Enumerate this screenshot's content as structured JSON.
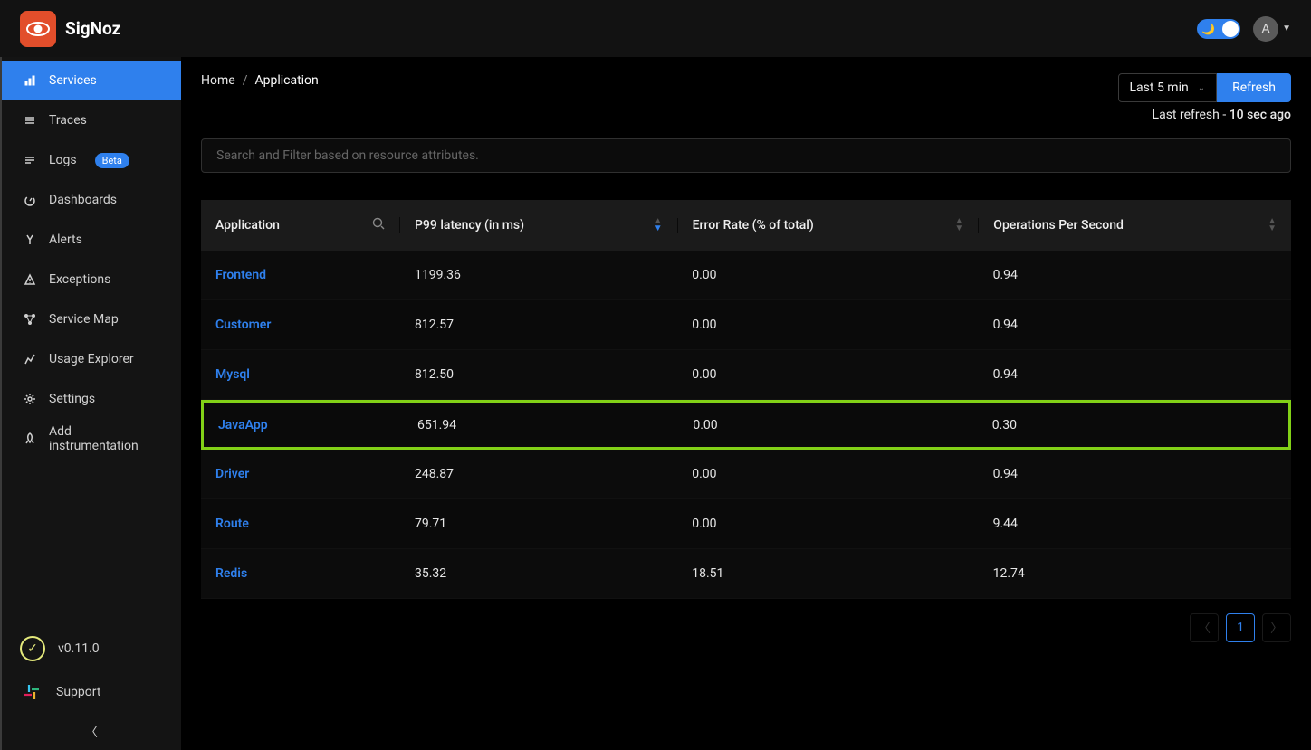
{
  "brand": "SigNoz",
  "avatar_initial": "A",
  "sidebar": {
    "items": [
      {
        "label": "Services",
        "active": true
      },
      {
        "label": "Traces"
      },
      {
        "label": "Logs",
        "badge": "Beta"
      },
      {
        "label": "Dashboards"
      },
      {
        "label": "Alerts"
      },
      {
        "label": "Exceptions"
      },
      {
        "label": "Service Map"
      },
      {
        "label": "Usage Explorer"
      },
      {
        "label": "Settings"
      },
      {
        "label": "Add instrumentation"
      }
    ],
    "version": "v0.11.0",
    "support": "Support"
  },
  "breadcrumb": {
    "home": "Home",
    "current": "Application"
  },
  "time_range_label": "Last 5 min",
  "refresh_label": "Refresh",
  "last_refresh_prefix": "Last refresh - ",
  "last_refresh_value": "10 sec ago",
  "search_placeholder": "Search and Filter based on resource attributes.",
  "columns": {
    "application": "Application",
    "p99": "P99 latency (in ms)",
    "error_rate": "Error Rate (% of total)",
    "ops": "Operations Per Second"
  },
  "rows": [
    {
      "app": "Frontend",
      "p99": "1199.36",
      "err": "0.00",
      "ops": "0.94"
    },
    {
      "app": "Customer",
      "p99": "812.57",
      "err": "0.00",
      "ops": "0.94"
    },
    {
      "app": "Mysql",
      "p99": "812.50",
      "err": "0.00",
      "ops": "0.94"
    },
    {
      "app": "JavaApp",
      "p99": "651.94",
      "err": "0.00",
      "ops": "0.30",
      "highlight": true
    },
    {
      "app": "Driver",
      "p99": "248.87",
      "err": "0.00",
      "ops": "0.94"
    },
    {
      "app": "Route",
      "p99": "79.71",
      "err": "0.00",
      "ops": "9.44"
    },
    {
      "app": "Redis",
      "p99": "35.32",
      "err": "18.51",
      "ops": "12.74"
    }
  ],
  "pagination": {
    "current": "1"
  }
}
